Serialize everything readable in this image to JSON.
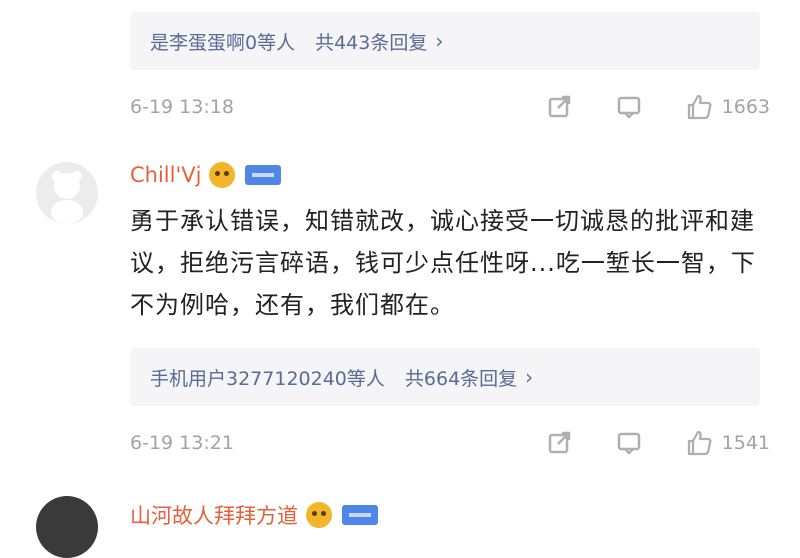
{
  "comments": [
    {
      "reply_summary": {
        "users": "是李蛋蛋啊0等人",
        "count": "共443条回复"
      },
      "time": "6-19 13:18",
      "likes": "1663"
    },
    {
      "username": "Chill'Vj",
      "text": "勇于承认错误，知错就改，诚心接受一切诚恳的批评和建议，拒绝污言碎语，钱可少点任性呀...吃一堑长一智，下不为例哈，还有，我们都在。",
      "reply_summary": {
        "users": "手机用户3277120240等人",
        "count": "共664条回复"
      },
      "time": "6-19 13:21",
      "likes": "1541"
    },
    {
      "username": "山河故人拜拜方道"
    }
  ],
  "icons": {
    "share": "share-icon",
    "comment": "comment-icon",
    "like": "thumbs-up-icon",
    "chevron": "chevron-right-icon"
  },
  "colors": {
    "username": "#e8603a",
    "reply_link": "#5b6b97",
    "meta": "#a3a3a3",
    "badge": "#4f86e8"
  }
}
